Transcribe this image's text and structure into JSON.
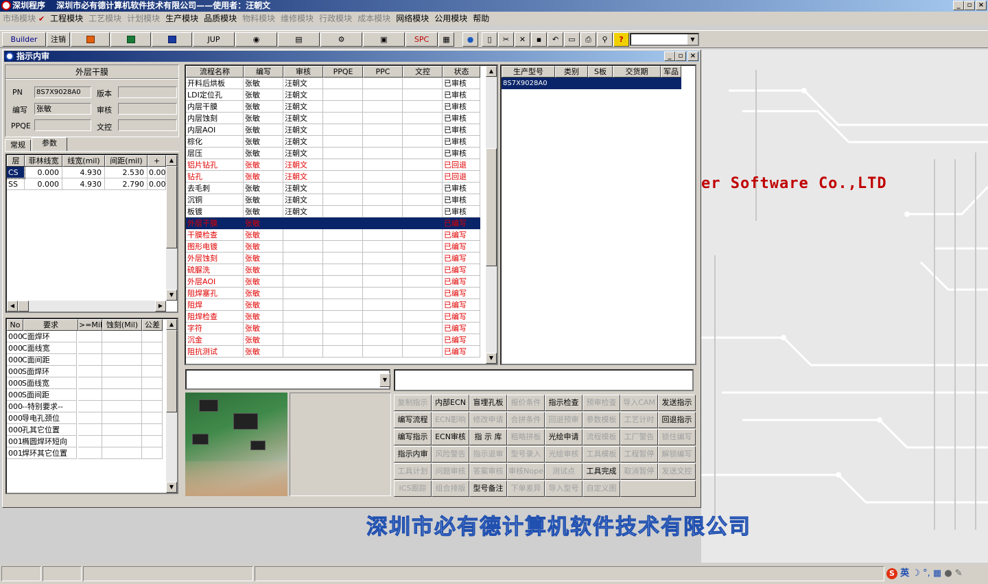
{
  "window": {
    "title": "深圳程序　 深圳市必有德计算机软件技术有限公司——使用者：汪朝文",
    "min": "_",
    "max": "▫",
    "close": "×"
  },
  "menu": [
    {
      "label": "市场模块",
      "enabled": false
    },
    {
      "label": "工程模块",
      "enabled": true,
      "checked": true
    },
    {
      "label": "工艺模块",
      "enabled": false
    },
    {
      "label": "计划模块",
      "enabled": false
    },
    {
      "label": "生产模块",
      "enabled": true
    },
    {
      "label": "品质模块",
      "enabled": true
    },
    {
      "label": "物料模块",
      "enabled": false
    },
    {
      "label": "维修模块",
      "enabled": false
    },
    {
      "label": "行政模块",
      "enabled": false
    },
    {
      "label": "成本模块",
      "enabled": false
    },
    {
      "label": "网络模块",
      "enabled": true
    },
    {
      "label": "公用模块",
      "enabled": true
    },
    {
      "label": "帮助",
      "enabled": true
    }
  ],
  "toolbar": {
    "builder": "Builder",
    "logout": "注销",
    "jup": "JUP",
    "spc": "SPC",
    "icons": [
      "powerpoint-icon",
      "excel-icon",
      "word-icon",
      "eye-icon",
      "database-icon",
      "network-icon",
      "printer-device-icon",
      "calendar-icon",
      "globe-icon",
      "new-icon",
      "cut-icon",
      "delete-icon",
      "save-icon",
      "undo-icon",
      "preview-icon",
      "print-icon",
      "find-icon",
      "help-icon"
    ]
  },
  "child": {
    "title": "指示内审"
  },
  "left": {
    "section": "外层干膜",
    "pn_label": "PN",
    "pn_value": "8S7X9028A0",
    "version_label": "版本",
    "writer_label": "编写",
    "writer_value": "张敏",
    "review_label": "审核",
    "ppqe_label": "PPQE",
    "doc_label": "文控",
    "tab_general": "常规",
    "tab_params": "参数",
    "param_headers": [
      "层",
      "菲林线宽",
      "线宽(mil)",
      "间距(mil)",
      "+"
    ],
    "param_rows": [
      [
        "CS",
        "0.000",
        "4.930",
        "2.530",
        "0.00"
      ],
      [
        "SS",
        "0.000",
        "4.930",
        "2.790",
        "0.00"
      ]
    ],
    "req_headers": [
      "No",
      "要求",
      ">=Mil",
      "蚀刻(Mil)",
      "公差"
    ],
    "req_rows": [
      [
        "000",
        "C面焊环"
      ],
      [
        "000",
        "C面线宽"
      ],
      [
        "000",
        "C面间距"
      ],
      [
        "000",
        "S面焊环"
      ],
      [
        "000",
        "S面线宽"
      ],
      [
        "000",
        "S面间距"
      ],
      [
        "000",
        "--特别要求--"
      ],
      [
        "000",
        "导电孔颈位"
      ],
      [
        "000",
        "孔其它位置"
      ],
      [
        "001",
        "椭圆焊环短向"
      ],
      [
        "001",
        "焊环其它位置"
      ]
    ]
  },
  "flow": {
    "headers": [
      "流程名称",
      "编写",
      "审核",
      "PPQE",
      "PPC",
      "文控",
      "状态"
    ],
    "rows": [
      {
        "name": "开料后烘板",
        "writer": "张敏",
        "reviewer": "汪朝文",
        "status": "已审核",
        "red": false
      },
      {
        "name": "LDI定位孔",
        "writer": "张敏",
        "reviewer": "汪朝文",
        "status": "已审核",
        "red": false
      },
      {
        "name": "内层干膜",
        "writer": "张敏",
        "reviewer": "汪朝文",
        "status": "已审核",
        "red": false
      },
      {
        "name": "内层蚀刻",
        "writer": "张敏",
        "reviewer": "汪朝文",
        "status": "已审核",
        "red": false
      },
      {
        "name": "内层AOI",
        "writer": "张敏",
        "reviewer": "汪朝文",
        "status": "已审核",
        "red": false
      },
      {
        "name": "棕化",
        "writer": "张敏",
        "reviewer": "汪朝文",
        "status": "已审核",
        "red": false
      },
      {
        "name": "层压",
        "writer": "张敏",
        "reviewer": "汪朝文",
        "status": "已审核",
        "red": false
      },
      {
        "name": "铝片钻孔",
        "writer": "张敏",
        "reviewer": "汪朝文",
        "status": "已回退",
        "red": true
      },
      {
        "name": "钻孔",
        "writer": "张敏",
        "reviewer": "汪朝文",
        "status": "已回退",
        "red": true
      },
      {
        "name": "去毛刺",
        "writer": "张敏",
        "reviewer": "汪朝文",
        "status": "已审核",
        "red": false
      },
      {
        "name": "沉铜",
        "writer": "张敏",
        "reviewer": "汪朝文",
        "status": "已审核",
        "red": false
      },
      {
        "name": "板镀",
        "writer": "张敏",
        "reviewer": "汪朝文",
        "status": "已审核",
        "red": false
      },
      {
        "name": "外层干膜",
        "writer": "张敏",
        "reviewer": "",
        "status": "已编写",
        "red": true,
        "selected": true
      },
      {
        "name": "干膜检查",
        "writer": "张敏",
        "reviewer": "",
        "status": "已编写",
        "red": true
      },
      {
        "name": "图形电镀",
        "writer": "张敏",
        "reviewer": "",
        "status": "已编写",
        "red": true
      },
      {
        "name": "外层蚀刻",
        "writer": "张敏",
        "reviewer": "",
        "status": "已编写",
        "red": true
      },
      {
        "name": "硫脲洗",
        "writer": "张敏",
        "reviewer": "",
        "status": "已编写",
        "red": true
      },
      {
        "name": "外层AOI",
        "writer": "张敏",
        "reviewer": "",
        "status": "已编写",
        "red": true
      },
      {
        "name": "阻焊塞孔",
        "writer": "张敏",
        "reviewer": "",
        "status": "已编写",
        "red": true
      },
      {
        "name": "阻焊",
        "writer": "张敏",
        "reviewer": "",
        "status": "已编写",
        "red": true
      },
      {
        "name": "阻焊检查",
        "writer": "张敏",
        "reviewer": "",
        "status": "已编写",
        "red": true
      },
      {
        "name": "字符",
        "writer": "张敏",
        "reviewer": "",
        "status": "已编写",
        "red": true
      },
      {
        "name": "沉金",
        "writer": "张敏",
        "reviewer": "",
        "status": "已编写",
        "red": true
      },
      {
        "name": "阻抗测试",
        "writer": "张敏",
        "reviewer": "",
        "status": "已编写",
        "red": true
      }
    ]
  },
  "prod": {
    "headers": [
      "生产型号",
      "类别",
      "S板",
      "交货期",
      "军品"
    ],
    "rows": [
      [
        "8S7X9028A0",
        "",
        "",
        "",
        ""
      ]
    ]
  },
  "buttons": [
    [
      "复制指示",
      "内部ECN",
      "盲埋孔板",
      "报价条件",
      "指示检查",
      "预审检查",
      "导入CAM",
      "发送指示"
    ],
    [
      "编写流程",
      "ECN影响",
      "修改申请",
      "合拼条件",
      "回退预审",
      "参数模板",
      "工艺计时",
      "回退指示"
    ],
    [
      "编写指示",
      "ECN审核",
      "指 示 库",
      "粗略拼板",
      "光绘申请",
      "流程模板",
      "工厂警告",
      "锁住编写"
    ],
    [
      "指示内审",
      "风险警告",
      "指示退审",
      "型号录入",
      "光绘审核",
      "工具模板",
      "工程暂停",
      "解锁编写"
    ],
    [
      "工具计划",
      "问题审核",
      "答案审核",
      "审核Nope",
      "测试点",
      "工具完成",
      "取消暂停",
      "发送文控"
    ],
    [
      "ICS跟踪",
      "组合排版",
      "型号备注",
      "下单差异",
      "导入型号",
      "自定义图",
      ""
    ]
  ],
  "buttons_enabled": [
    [
      false,
      true,
      true,
      false,
      true,
      false,
      false,
      true
    ],
    [
      true,
      false,
      false,
      false,
      false,
      false,
      false,
      true
    ],
    [
      true,
      true,
      true,
      false,
      true,
      false,
      false,
      false
    ],
    [
      true,
      false,
      false,
      false,
      false,
      false,
      false,
      false
    ],
    [
      false,
      false,
      false,
      false,
      false,
      true,
      false,
      false
    ],
    [
      false,
      false,
      true,
      false,
      false,
      false,
      false
    ]
  ],
  "watermark": {
    "en": "er Software Co.,LTD",
    "cn": "深圳市必有德计算机软件技术有限公司"
  },
  "tray": {
    "ime": "英"
  },
  "colors": {
    "title_start": "#0a246a",
    "title_end": "#a6caf0",
    "red_text": "#e00000",
    "selected_row": "#0a246a"
  }
}
